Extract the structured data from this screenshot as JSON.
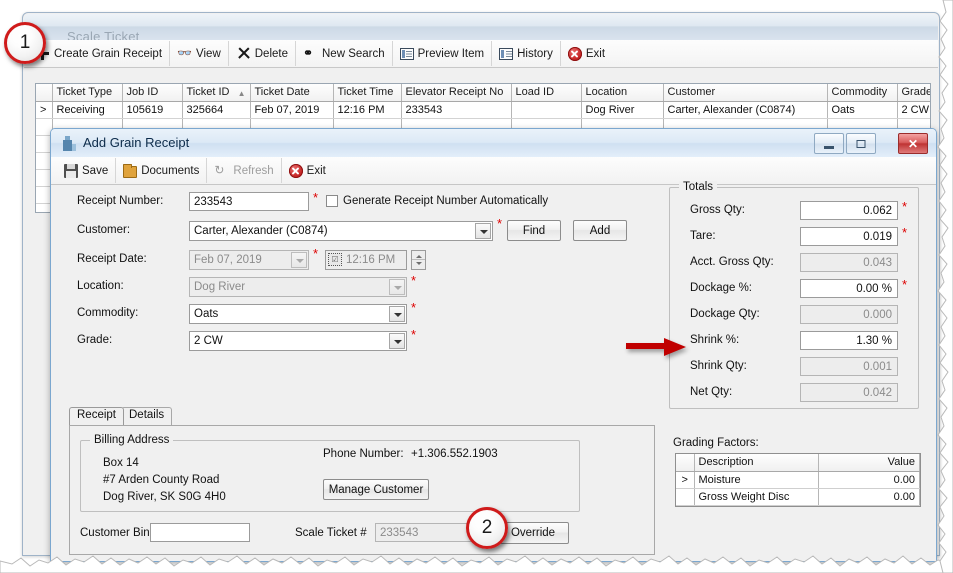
{
  "background_window": {
    "title": "Scale Ticket",
    "toolbar": [
      {
        "label": "Create Grain Receipt",
        "icon": "plus-icon"
      },
      {
        "label": "View",
        "icon": "glasses-icon"
      },
      {
        "label": "Delete",
        "icon": "x-icon"
      },
      {
        "label": "New Search",
        "icon": "binoculars-icon"
      },
      {
        "label": "Preview Item",
        "icon": "document-icon"
      },
      {
        "label": "History",
        "icon": "document-icon"
      },
      {
        "label": "Exit",
        "icon": "exit-icon"
      }
    ],
    "grid": {
      "row_marker": ">",
      "sort_indicator": "▲",
      "sorted_column": "Ticket ID",
      "columns": [
        "Ticket Type",
        "Job ID",
        "Ticket ID",
        "Ticket Date",
        "Ticket Time",
        "Elevator Receipt No",
        "Load ID",
        "Location",
        "Customer",
        "Commodity",
        "Grade"
      ],
      "rows": [
        {
          "ticket_type": "Receiving",
          "job_id": "105619",
          "ticket_id": "325664",
          "ticket_date": "Feb 07, 2019",
          "ticket_time": "12:16 PM",
          "elevator_receipt_no": "233543",
          "load_id": "",
          "location": "Dog River",
          "customer": "Carter, Alexander (C0874)",
          "commodity": "Oats",
          "grade": "2 CW"
        }
      ]
    },
    "row_number_gutter": "8"
  },
  "dialog": {
    "title": "Add Grain Receipt",
    "window_buttons": {
      "minimize": "—",
      "maximize": "□",
      "close": "✕"
    },
    "toolbar": [
      {
        "label": "Save",
        "icon": "save-icon",
        "disabled": false
      },
      {
        "label": "Documents",
        "icon": "folder-icon",
        "disabled": false
      },
      {
        "label": "Refresh",
        "icon": "refresh-icon",
        "disabled": true
      },
      {
        "label": "Exit",
        "icon": "exit-icon",
        "disabled": false
      }
    ],
    "form": {
      "receipt_number_label": "Receipt Number:",
      "receipt_number_value": "233543",
      "generate_receipt_label": "Generate Receipt Number Automatically",
      "generate_receipt_checked": false,
      "customer_label": "Customer:",
      "customer_value": "Carter, Alexander (C0874)",
      "find_button": "Find",
      "add_button": "Add",
      "receipt_date_label": "Receipt Date:",
      "receipt_date_value": "Feb 07, 2019",
      "receipt_time_value": "12:16 PM",
      "location_label": "Location:",
      "location_value": "Dog River",
      "commodity_label": "Commodity:",
      "commodity_value": "Oats",
      "grade_label": "Grade:",
      "grade_value": "2 CW",
      "required_marker": "*"
    },
    "totals": {
      "title": "Totals",
      "rows": [
        {
          "label": "Gross Qty:",
          "value": "0.062",
          "readonly": false,
          "required": true
        },
        {
          "label": "Tare:",
          "value": "0.019",
          "readonly": false,
          "required": true
        },
        {
          "label": "Acct. Gross Qty:",
          "value": "0.043",
          "readonly": true,
          "required": false
        },
        {
          "label": "Dockage %:",
          "value": "0.00 %",
          "readonly": false,
          "required": true
        },
        {
          "label": "Dockage Qty:",
          "value": "0.000",
          "readonly": true,
          "required": false
        },
        {
          "label": "Shrink %:",
          "value": "1.30 %",
          "readonly": false,
          "required": false
        },
        {
          "label": "Shrink Qty:",
          "value": "0.001",
          "readonly": true,
          "required": false
        },
        {
          "label": "Net Qty:",
          "value": "0.042",
          "readonly": true,
          "required": false
        }
      ]
    },
    "tabs": [
      {
        "label": "Receipt",
        "active": true
      },
      {
        "label": "Details",
        "active": false
      }
    ],
    "receipt_tab": {
      "billing_address": {
        "title": "Billing Address",
        "line1": "Box 14",
        "line2": "#7 Arden County Road",
        "line3": "Dog River, SK S0G 4H0",
        "phone_label": "Phone Number:",
        "phone_value": "+1.306.552.1903",
        "manage_customer_button": "Manage Customer"
      },
      "customer_bin_label": "Customer Bin:",
      "customer_bin_value": "",
      "scale_ticket_label": "Scale Ticket #",
      "scale_ticket_value": "233543",
      "override_button": "Override"
    },
    "grading_factors": {
      "title": "Grading Factors:",
      "row_marker": ">",
      "columns": [
        "",
        "Description",
        "Value"
      ],
      "rows": [
        {
          "marker": ">",
          "description": "Moisture",
          "value": "0.00"
        },
        {
          "marker": "",
          "description": "Gross Weight Disc",
          "value": "0.00"
        }
      ]
    }
  },
  "annotations": {
    "callouts": [
      {
        "number": "1"
      },
      {
        "number": "2"
      }
    ],
    "arrow_target": "Shrink %:",
    "accent_color": "#cf1b1b"
  }
}
